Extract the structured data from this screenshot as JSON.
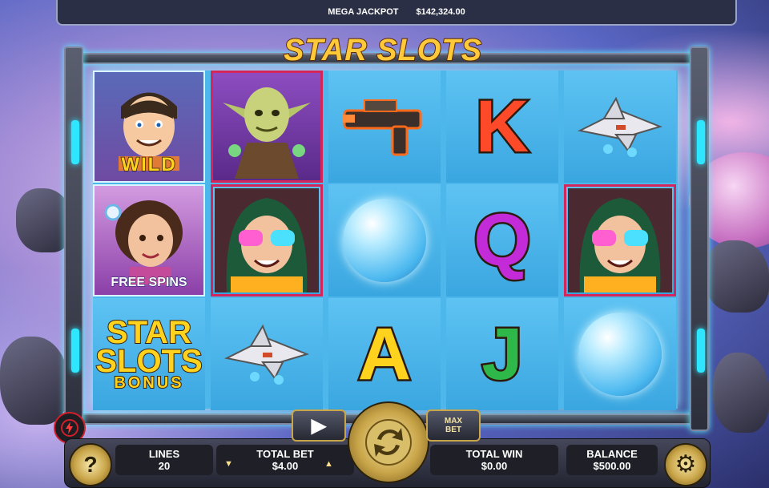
{
  "jackpot": {
    "label": "MEGA JACKPOT",
    "value": "$142,324.00"
  },
  "logo": {
    "text": "STAR SLOTS"
  },
  "symbols": {
    "wild": "WILD",
    "free_spins": "FREE SPINS",
    "bonus_line1": "STAR",
    "bonus_line2": "SLOTS",
    "bonus_line3": "BONUS",
    "k": "K",
    "q": "Q",
    "a": "A",
    "j": "J"
  },
  "controls": {
    "lines_label": "LINES",
    "lines_value": "20",
    "total_bet_label": "TOTAL BET",
    "total_bet_value": "$4.00",
    "bet_down": "▼",
    "bet_up": "▲",
    "total_win_label": "TOTAL WIN",
    "total_win_value": "$0.00",
    "balance_label": "BALANCE",
    "balance_value": "$500.00",
    "max_bet_line1": "MAX",
    "max_bet_line2": "BET",
    "help": "?",
    "play_glyph": "▶",
    "settings_glyph": "⚙"
  },
  "colors": {
    "accent_gold": "#c9a549",
    "reel_blue": "#4db6ea",
    "frame_glow": "#2ee6ff",
    "turbo_red": "#d11f2a"
  }
}
